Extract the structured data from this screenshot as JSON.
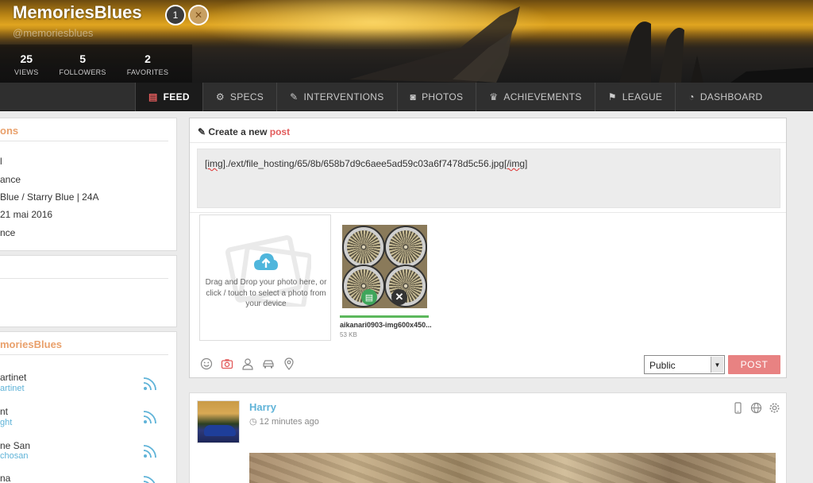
{
  "profile": {
    "name": "MemoriesBlues",
    "handle": "@memoriesblues",
    "badges": {
      "calendar": "calendar-badge-icon",
      "achievement": "achievement-badge-icon",
      "calendar_day": "1"
    },
    "stats": [
      {
        "num": "25",
        "label": "VIEWS"
      },
      {
        "num": "5",
        "label": "FOLLOWERS"
      },
      {
        "num": "2",
        "label": "FAVORITES"
      }
    ]
  },
  "nav": [
    {
      "label": "FEED",
      "icon": "newspaper-icon",
      "glyph": "▤",
      "active": true
    },
    {
      "label": "SPECS",
      "icon": "gears-icon",
      "glyph": "⚙"
    },
    {
      "label": "INTERVENTIONS",
      "icon": "wrench-icon",
      "glyph": "🔧"
    },
    {
      "label": "PHOTOS",
      "icon": "camera-icon",
      "glyph": "📷"
    },
    {
      "label": "ACHIEVEMENTS",
      "icon": "trophy-icon",
      "glyph": "🏆"
    },
    {
      "label": "LEAGUE",
      "icon": "flag-icon",
      "glyph": "⚑"
    },
    {
      "label": "DASHBOARD",
      "icon": "dashboard-icon",
      "glyph": "◔"
    }
  ],
  "left": {
    "info_title": "ons",
    "info_rows": [
      "l",
      "ance",
      "Blue / Starry Blue | 24A",
      "21 mai 2016",
      "nce"
    ],
    "followers_title": "moriesBlues",
    "followers": [
      {
        "name": "artinet",
        "sub": "artinet"
      },
      {
        "name": "nt",
        "sub": "ght"
      },
      {
        "name": "ne San",
        "sub": "chosan"
      },
      {
        "name": "na",
        "sub": ""
      }
    ]
  },
  "create": {
    "title_prefix": "Create a new ",
    "title_post": "post",
    "textarea_tag_open": "[img]",
    "textarea_path": "./ext/file_hosting/65/8b/658b7d9c6aee5ad59c03a6f7478d5c56.jpg",
    "textarea_tag_close": "[/img]",
    "dropzone_text": "Drag and Drop your photo here, or click / touch to select a photo from your device",
    "upload": {
      "filename": "aikanari0903-img600x450...",
      "size": "53 KB",
      "progress": 1.0
    },
    "visibility": "Public",
    "post_label": "POST"
  },
  "feed": [
    {
      "author": "Harry",
      "time": "12 minutes ago"
    }
  ],
  "colors": {
    "accent": "#e25b5b",
    "link": "#5fb3d8",
    "orange": "#e9a06b",
    "success": "#5cb85c"
  }
}
